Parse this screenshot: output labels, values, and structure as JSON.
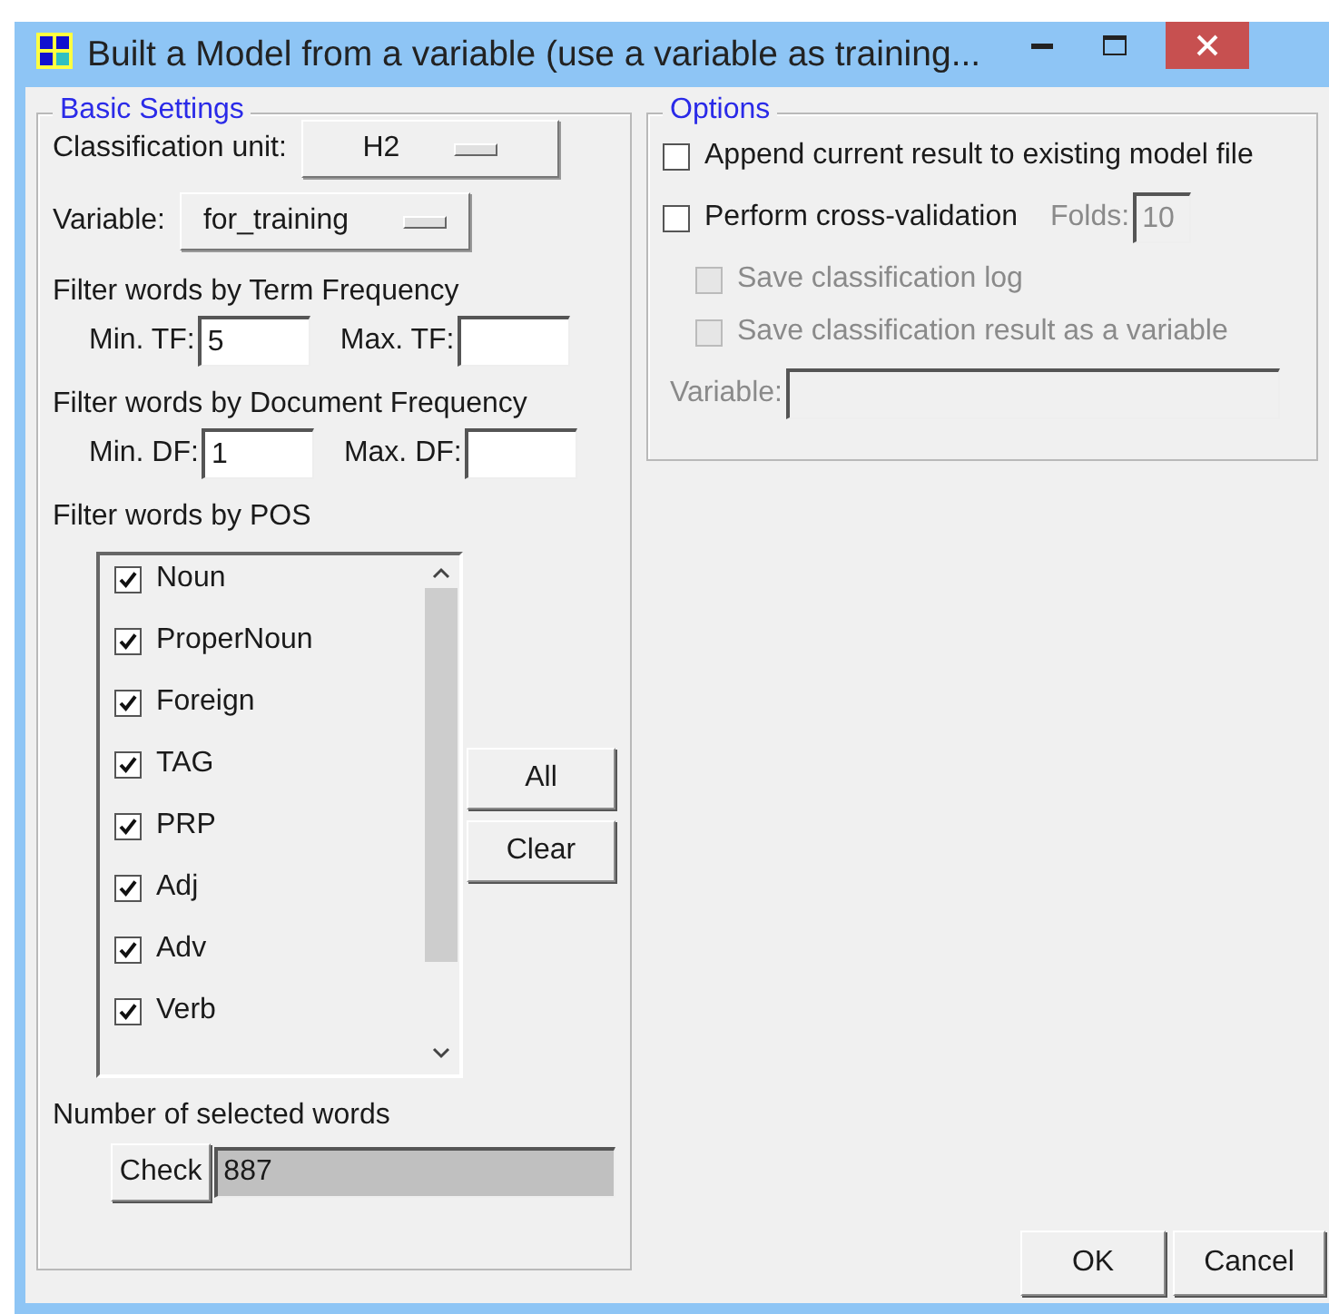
{
  "window": {
    "title": "Built a Model from a variable (use a variable as training..."
  },
  "basic_settings": {
    "title": "Basic Settings",
    "classification_unit": {
      "label": "Classification unit:",
      "value": "H2"
    },
    "variable": {
      "label": "Variable:",
      "value": "for_training"
    },
    "tf_heading": "Filter words by Term Frequency",
    "tf_fields": [
      {
        "label": "Min. TF:",
        "value": "5"
      },
      {
        "label": "Max. TF:"
      }
    ],
    "df_heading": "Filter words by Document Frequency",
    "df_fields": [
      {
        "label": "Min. DF:",
        "value": "1"
      },
      {
        "label": "Max. DF:"
      }
    ],
    "pos_heading": "Filter words by POS",
    "pos_items": [
      {
        "label": "Noun",
        "checked": true
      },
      {
        "label": "ProperNoun",
        "checked": true
      },
      {
        "label": "Foreign",
        "checked": true
      },
      {
        "label": "TAG",
        "checked": true
      },
      {
        "label": "PRP",
        "checked": true
      },
      {
        "label": "Adj",
        "checked": true
      },
      {
        "label": "Adv",
        "checked": true
      },
      {
        "label": "Verb",
        "checked": true
      }
    ],
    "pos_buttons": [
      "All",
      "Clear"
    ],
    "count_label": "Number of selected words",
    "check_button": "Check",
    "count_value": "887"
  },
  "options": {
    "title": "Options",
    "items": [
      {
        "kind": "checkbox",
        "label": "Append current result to existing model file",
        "checked": false,
        "disabled": false
      },
      {
        "kind": "checkbox",
        "label": "Perform cross-validation",
        "checked": false,
        "disabled": false,
        "field": {
          "label": "Folds:",
          "value": "10",
          "disabled": true
        },
        "children": [
          {
            "kind": "checkbox",
            "label": "Save classification log",
            "checked": false,
            "disabled": true
          },
          {
            "kind": "checkbox",
            "label": "Save classification result as a variable",
            "checked": false,
            "disabled": true
          },
          {
            "kind": "field",
            "label": "Variable:",
            "disabled": true
          }
        ]
      }
    ]
  },
  "footer_buttons": [
    "OK",
    "Cancel"
  ]
}
